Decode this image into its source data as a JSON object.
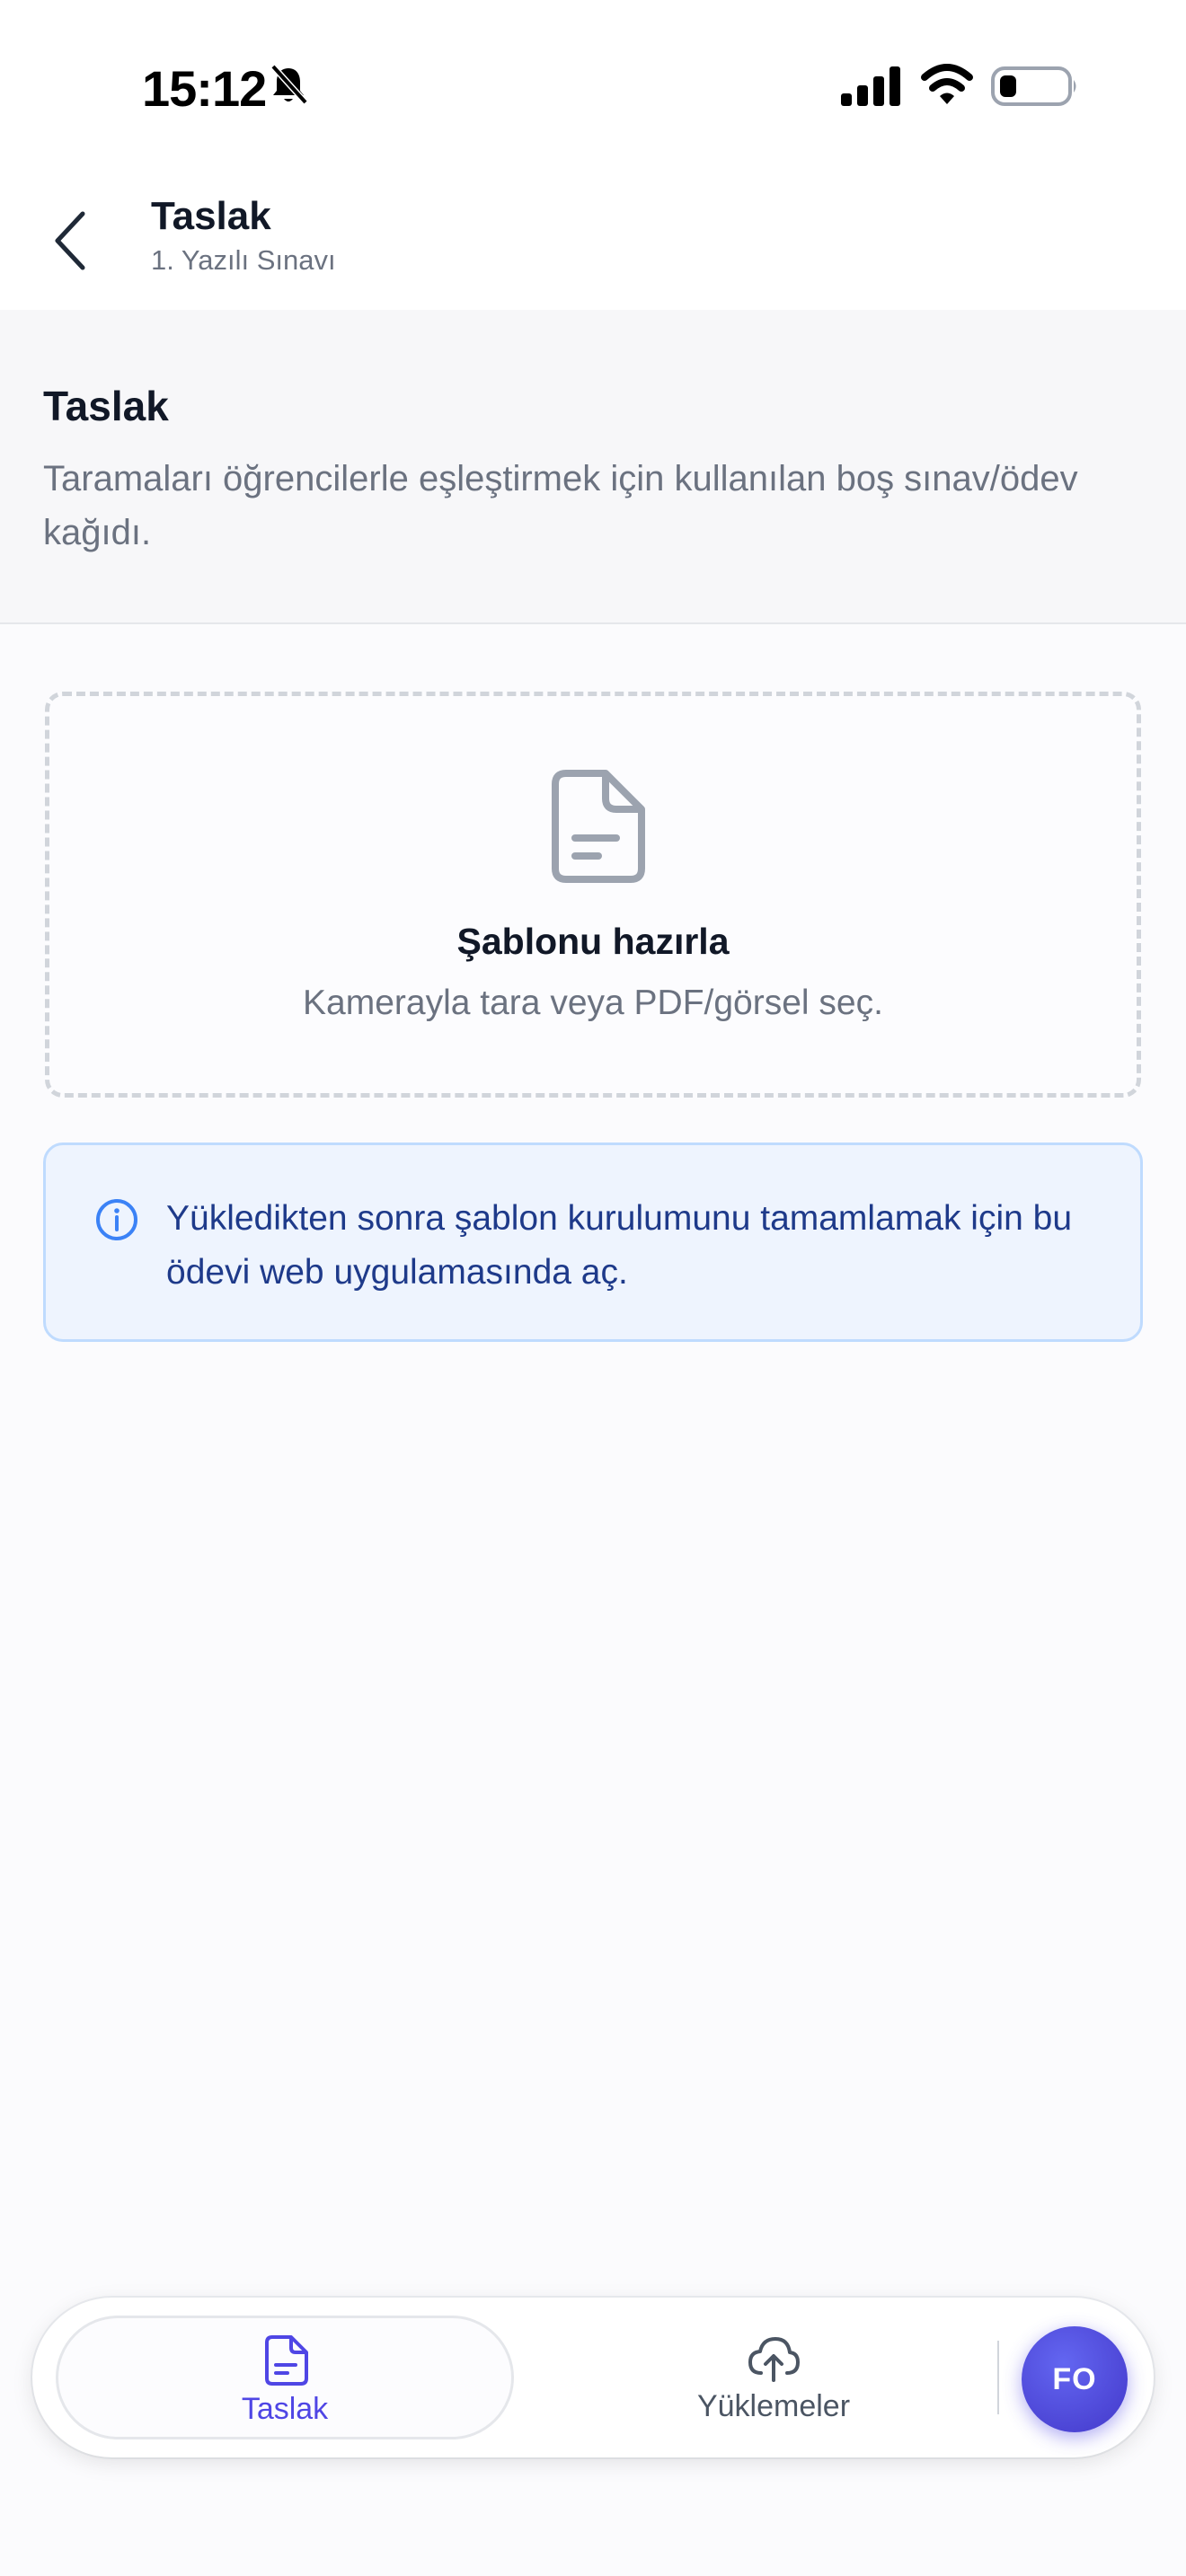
{
  "status_bar": {
    "time": "15:12"
  },
  "header": {
    "title": "Taslak",
    "subtitle": "1. Yazılı Sınavı"
  },
  "section": {
    "title": "Taslak",
    "description": "Taramaları öğrencilerle eşleştirmek için kullanılan boş sınav/ödev kağıdı."
  },
  "upload": {
    "title": "Şablonu hazırla",
    "subtitle": "Kamerayla tara veya PDF/görsel seç."
  },
  "info": {
    "text": "Yükledikten sonra şablon kurulumunu tamamlamak için bu ödevi web uygulamasında aç."
  },
  "nav": {
    "tabs": [
      {
        "label": "Taslak",
        "icon": "document-icon",
        "active": true
      },
      {
        "label": "Yüklemeler",
        "icon": "cloud-upload-icon",
        "active": false
      }
    ],
    "avatar_initials": "FO"
  },
  "colors": {
    "accent": "#4f46e5",
    "info_background": "#eef4fe",
    "info_text": "#1e3a8a",
    "muted_text": "#6b7280"
  }
}
